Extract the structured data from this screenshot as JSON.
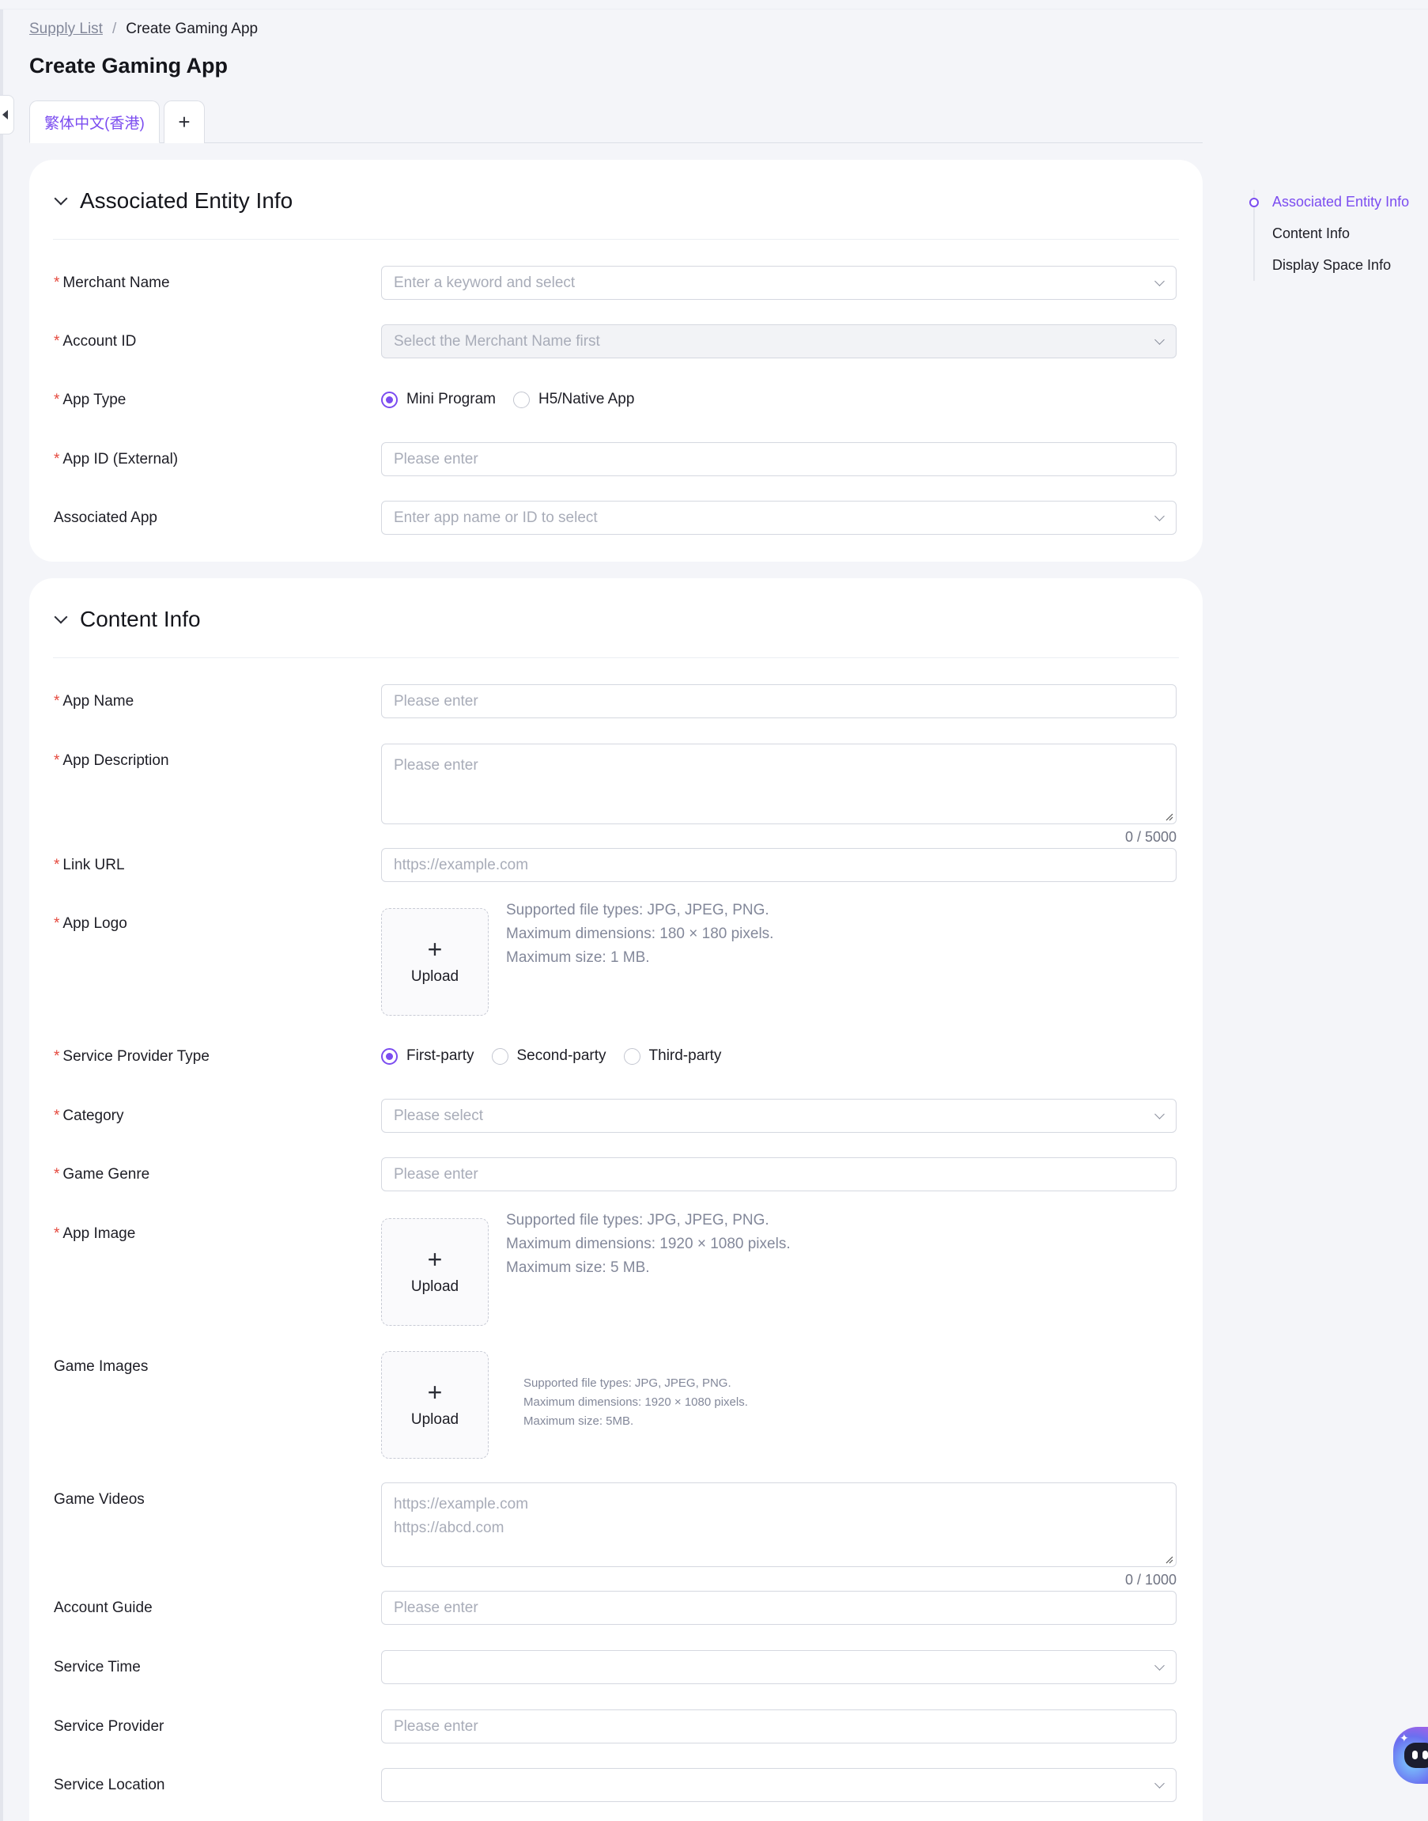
{
  "breadcrumb": {
    "parent": "Supply List",
    "separator": "/",
    "current": "Create Gaming App"
  },
  "page_title": "Create Gaming App",
  "language_tabs": {
    "active": "繁体中文(香港)",
    "add": "+"
  },
  "sections": {
    "entity": {
      "title": "Associated Entity Info"
    },
    "content": {
      "title": "Content Info"
    }
  },
  "entity_form": {
    "merchant_name": {
      "label": "Merchant Name",
      "placeholder": "Enter a keyword and select"
    },
    "account_id": {
      "label": "Account ID",
      "placeholder": "Select the Merchant Name first"
    },
    "app_type": {
      "label": "App Type",
      "options": [
        "Mini Program",
        "H5/Native App"
      ],
      "selected": "Mini Program"
    },
    "app_id_external": {
      "label": "App ID (External)",
      "placeholder": "Please enter"
    },
    "associated_app": {
      "label": "Associated App",
      "placeholder": "Enter app name or ID to select"
    }
  },
  "content_form": {
    "app_name": {
      "label": "App Name",
      "placeholder": "Please enter"
    },
    "app_description": {
      "label": "App Description",
      "placeholder": "Please enter",
      "counter": "0 / 5000"
    },
    "link_url": {
      "label": "Link URL",
      "placeholder": "https://example.com"
    },
    "app_logo": {
      "label": "App Logo",
      "upload_label": "Upload",
      "hints": [
        "Supported file types: JPG, JPEG, PNG.",
        "Maximum dimensions: 180 × 180 pixels.",
        "Maximum size: 1 MB."
      ]
    },
    "service_provider_type": {
      "label": "Service Provider Type",
      "options": [
        "First-party",
        "Second-party",
        "Third-party"
      ],
      "selected": "First-party"
    },
    "category": {
      "label": "Category",
      "placeholder": "Please select"
    },
    "game_genre": {
      "label": "Game Genre",
      "placeholder": "Please enter"
    },
    "app_image": {
      "label": "App Image",
      "upload_label": "Upload",
      "hints": [
        "Supported file types: JPG, JPEG, PNG.",
        "Maximum dimensions: 1920 × 1080 pixels.",
        "Maximum size: 5 MB."
      ]
    },
    "game_images": {
      "label": "Game Images",
      "upload_label": "Upload",
      "hints": [
        "Supported file types: JPG, JPEG, PNG.",
        "Maximum dimensions: 1920 × 1080 pixels.",
        "Maximum size: 5MB."
      ]
    },
    "game_videos": {
      "label": "Game Videos",
      "placeholder_lines": [
        "https://example.com",
        "https://abcd.com"
      ],
      "counter": "0 / 1000"
    },
    "account_guide": {
      "label": "Account Guide",
      "placeholder": "Please enter"
    },
    "service_time": {
      "label": "Service Time",
      "placeholder": ""
    },
    "service_provider": {
      "label": "Service Provider",
      "placeholder": "Please enter"
    },
    "service_location": {
      "label": "Service Location",
      "placeholder": ""
    }
  },
  "anchor_nav": {
    "items": [
      "Associated Entity Info",
      "Content Info",
      "Display Space Info"
    ],
    "active": "Associated Entity Info"
  },
  "colors": {
    "accent": "#7b4cf0",
    "required": "#e5483d",
    "page_bg": "#f4f5f9"
  },
  "icons": {
    "collapse": "triangle-left-icon",
    "chevron": "chevron-down-icon",
    "assistant": "assistant-bot-icon"
  }
}
